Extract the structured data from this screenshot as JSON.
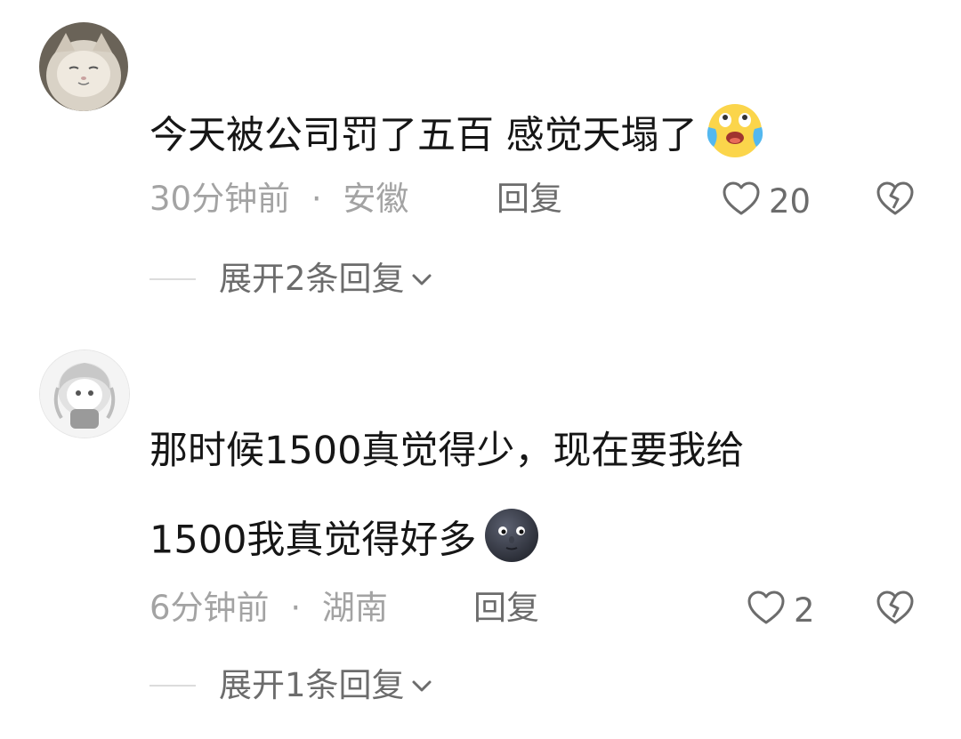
{
  "comments": [
    {
      "text": "今天被公司罚了五百 感觉天塌了",
      "emoji": "crying-laughing-face",
      "time": "30分钟前",
      "dot": "·",
      "location": "安徽",
      "reply_label": "回复",
      "likes": "20",
      "expand_label": "展开2条回复"
    },
    {
      "text_line1": "那时候1500真觉得少，现在要我给",
      "text_line2": "1500我真觉得好多",
      "emoji": "new-moon-face",
      "time": "6分钟前",
      "dot": "·",
      "location": "湖南",
      "reply_label": "回复",
      "likes": "2",
      "expand_label": "展开1条回复"
    }
  ]
}
